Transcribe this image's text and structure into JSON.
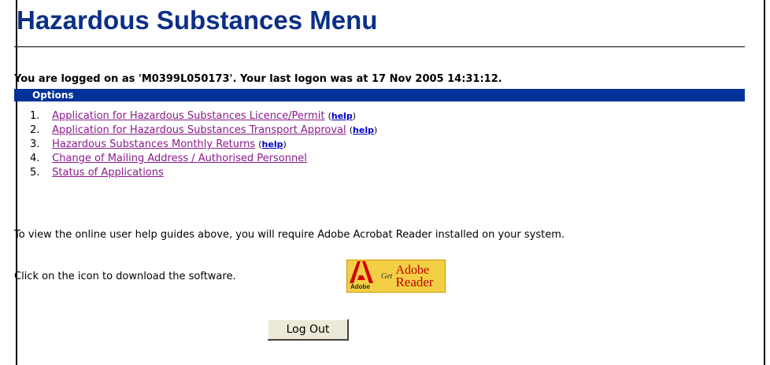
{
  "page": {
    "title": "Hazardous Substances Menu",
    "logon_message": "You are logged on as 'M0399L050173'. Your last logon was at 17 Nov 2005 14:31:12."
  },
  "options": {
    "heading": "Options",
    "items": [
      {
        "number": "1.",
        "label": "Application for Hazardous Substances Licence/Permit",
        "help": "help"
      },
      {
        "number": "2.",
        "label": "Application for Hazardous Substances Transport Approval",
        "help": "help"
      },
      {
        "number": "3.",
        "label": "Hazardous Substances Monthly Returns",
        "help": "help"
      },
      {
        "number": "4.",
        "label": "Change of Mailing Address / Authorised Personnel",
        "help": null
      },
      {
        "number": "5.",
        "label": "Status of Applications",
        "help": null
      }
    ]
  },
  "help_info": {
    "reader_requirement": "To view the online user help guides above, you will require Adobe Acrobat Reader installed on your system.",
    "download_prompt": "Click on the icon to download the software."
  },
  "adobe_badge": {
    "get_text": "Get",
    "line1": "Adobe",
    "line2": "Reader",
    "logo_caption": "Adobe",
    "icon": "adobe-reader-icon",
    "colors": {
      "background": "#f3cf45",
      "logo": "#d40000",
      "text": "#c00000"
    }
  },
  "actions": {
    "logout_label": "Log Out"
  },
  "colors": {
    "title": "#0a2f86",
    "options_bar": "#003399",
    "visited_link": "#8b1a8b",
    "help_link": "#0000cc"
  }
}
